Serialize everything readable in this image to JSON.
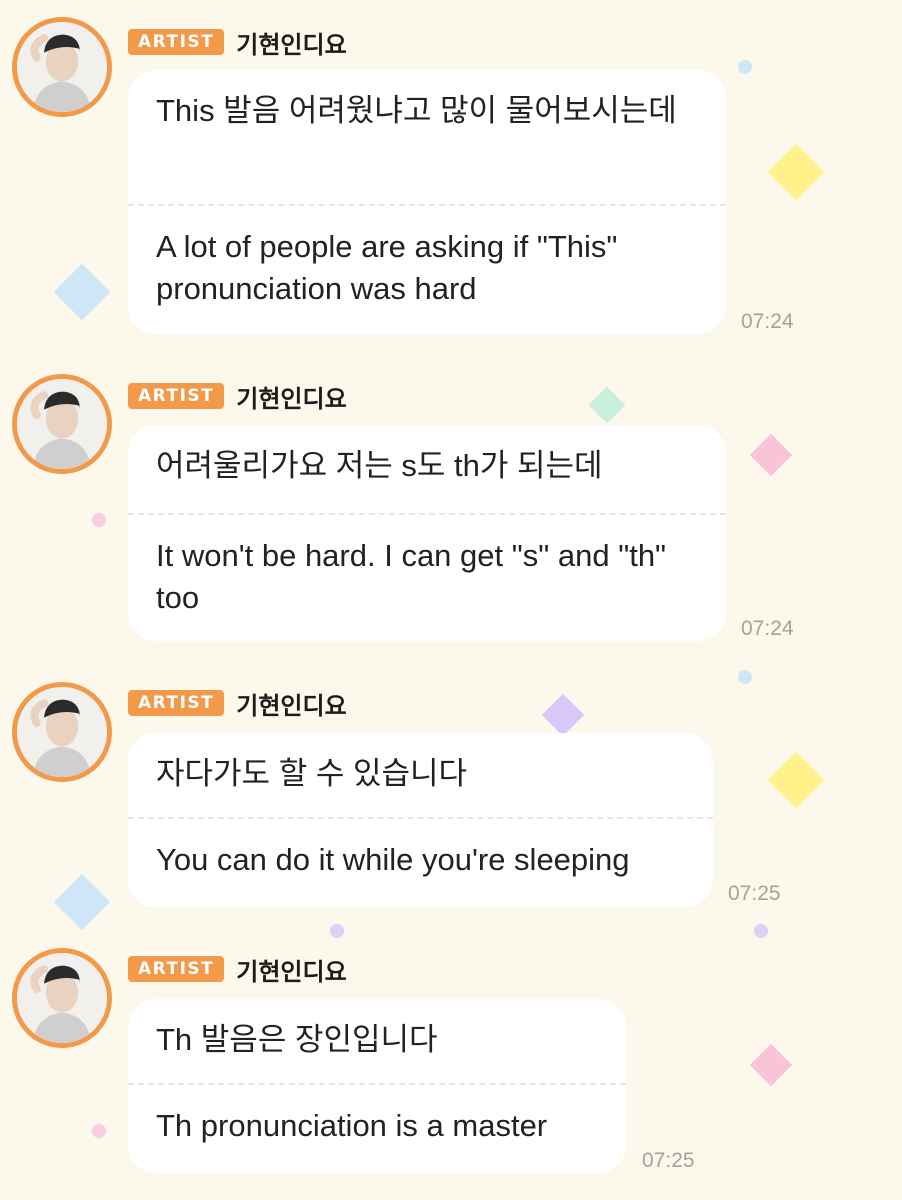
{
  "colors": {
    "background": "#fdf8ec",
    "badge": "#f2994a",
    "avatar_ring": "#f2994a",
    "bubble": "#ffffff",
    "timestamp": "#a5a29a"
  },
  "messages": [
    {
      "badge": "ARTIST",
      "sender": "기현인디요",
      "original": "This 발음 어려웠냐고 많이 물어보시는데",
      "translation": "A lot of people are asking if \"This\" pronunciation was hard",
      "time": "07:24"
    },
    {
      "badge": "ARTIST",
      "sender": "기현인디요",
      "original": "어려울리가요 저는 s도 th가 되는데",
      "translation": "It won't be hard. I can get \"s\" and \"th\" too",
      "time": "07:24"
    },
    {
      "badge": "ARTIST",
      "sender": "기현인디요",
      "original": "자다가도 할 수 있습니다",
      "translation": "You can do it while you're sleeping",
      "time": "07:25"
    },
    {
      "badge": "ARTIST",
      "sender": "기현인디요",
      "original": "Th 발음은 장인입니다",
      "translation": "Th pronunciation is a master",
      "time": "07:25"
    }
  ],
  "decorations": {
    "heart_colors": [
      "#fff28a",
      "#b8dcf5",
      "#c9f0df",
      "#f9c4d8",
      "#d9c8f7"
    ],
    "dot_colors": [
      "#cfe6f6",
      "#f8cfe0",
      "#dcd2f5"
    ]
  }
}
